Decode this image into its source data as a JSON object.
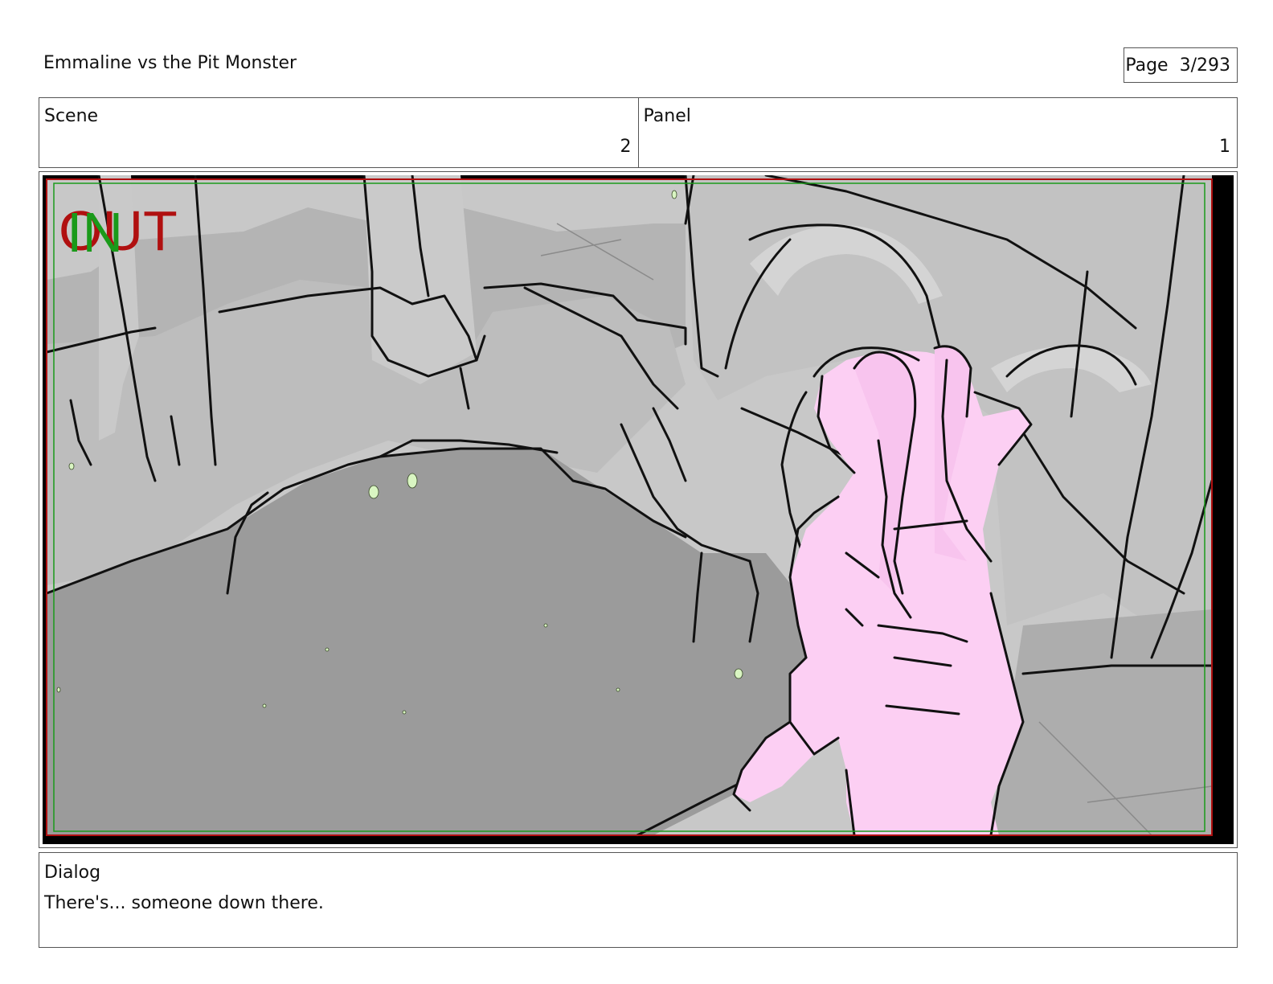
{
  "header": {
    "title": "Emmaline vs the Pit Monster",
    "page_label": "Page",
    "page_value": "3/293"
  },
  "info": {
    "scene_label": "Scene",
    "scene_value": "2",
    "panel_label": "Panel",
    "panel_value": "1"
  },
  "panel_image": {
    "overlay_out": "OUT",
    "overlay_in": "IN",
    "overlay_out_color": "#b01010",
    "overlay_in_color": "#1a9a1a",
    "character_color": "#fccff3"
  },
  "dialog": {
    "label": "Dialog",
    "text": "There's... someone down there."
  }
}
